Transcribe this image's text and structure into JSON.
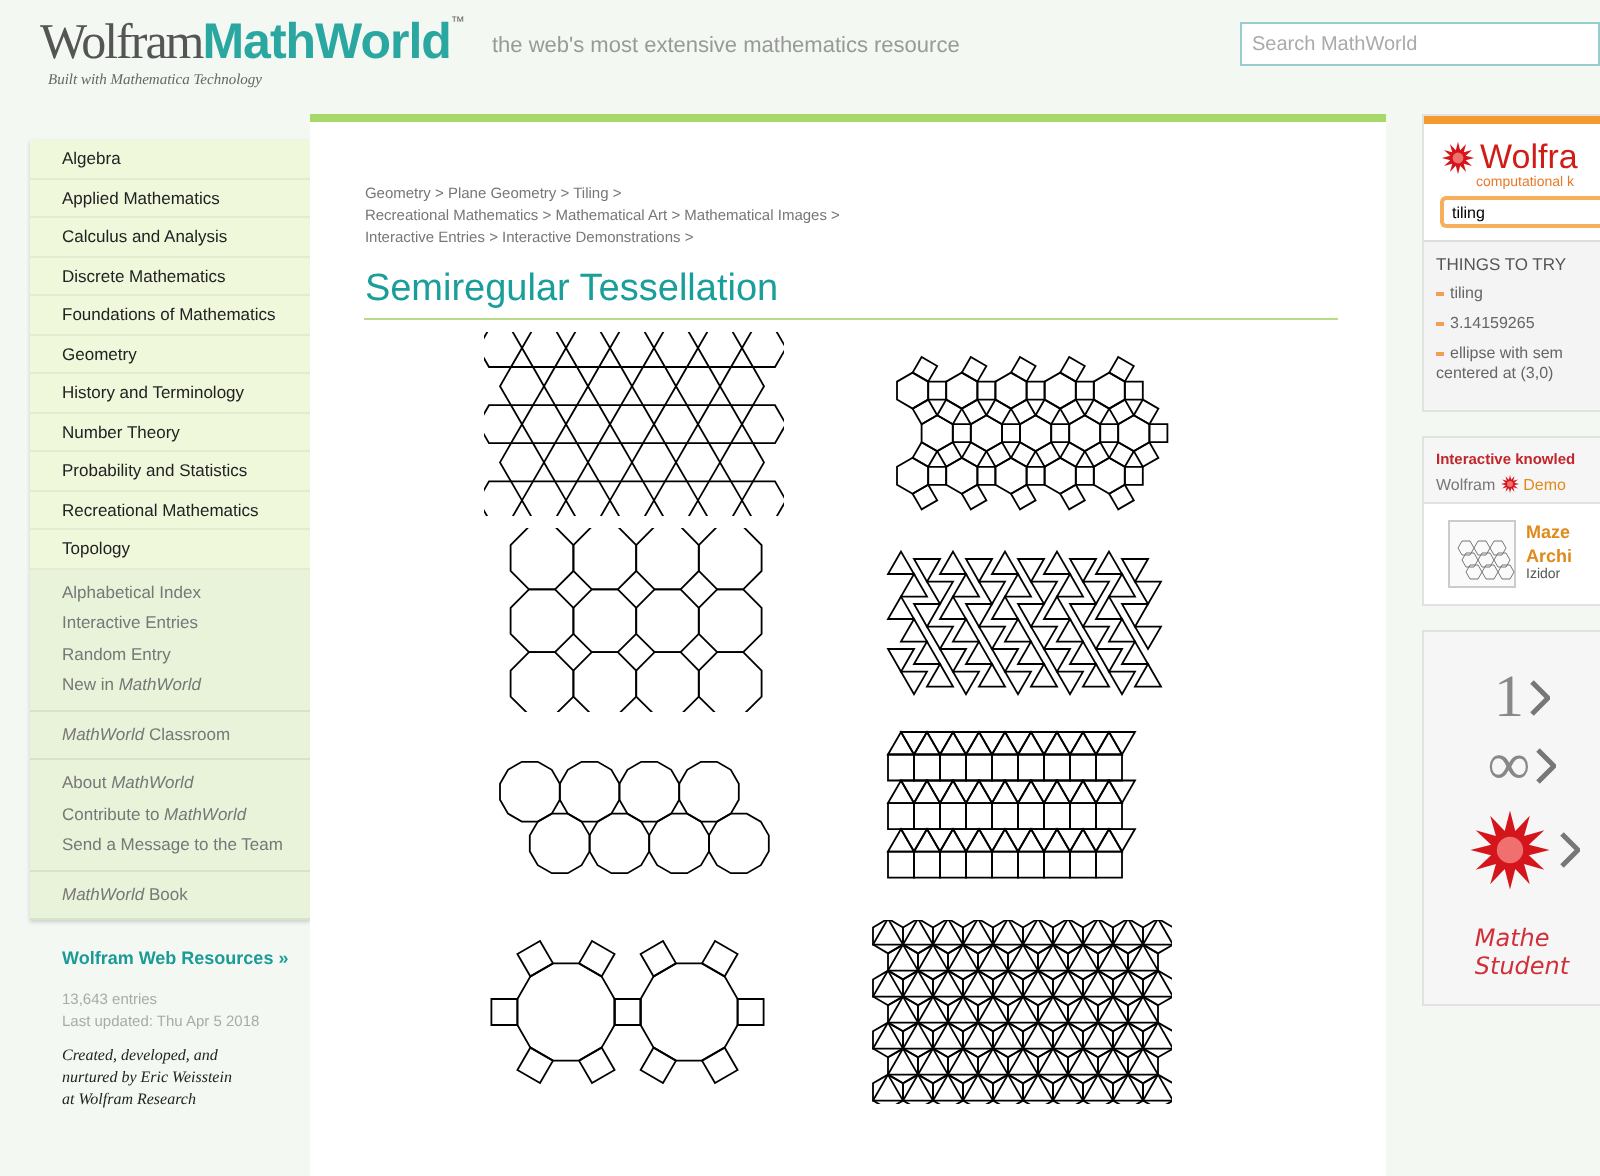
{
  "header": {
    "logo_left": "Wolfram",
    "logo_right": "MathWorld",
    "trademark": "™",
    "tagline": "the web's most extensive mathematics resource",
    "subtitle": "Built with Mathematica Technology",
    "search": {
      "placeholder": "Search MathWorld"
    }
  },
  "sidebar": {
    "topics": [
      "Algebra",
      "Applied Mathematics",
      "Calculus and Analysis",
      "Discrete Mathematics",
      "Foundations of Mathematics",
      "Geometry",
      "History and Terminology",
      "Number Theory",
      "Probability and Statistics",
      "Recreational Mathematics",
      "Topology"
    ],
    "groups": [
      [
        "Alphabetical Index",
        "Interactive Entries",
        "Random Entry",
        "New in *MathWorld*"
      ],
      [
        "*MathWorld* Classroom"
      ],
      [
        "About *MathWorld*",
        "Contribute to *MathWorld*",
        "Send a Message to the Team"
      ],
      [
        "*MathWorld* Book"
      ]
    ],
    "resources_link": "Wolfram Web Resources »",
    "entries": "13,643 entries",
    "updated": "Last updated: Thu Apr 5 2018",
    "credit": [
      "Created, developed, and",
      "nurtured by Eric Weisstein",
      "at Wolfram Research"
    ]
  },
  "breadcrumbs": [
    [
      "Geometry",
      "Plane Geometry",
      "Tiling"
    ],
    [
      "Recreational Mathematics",
      "Mathematical Art",
      "Mathematical Images"
    ],
    [
      "Interactive Entries",
      "Interactive Demonstrations"
    ]
  ],
  "separator": ">",
  "title": "Semiregular Tessellation",
  "alpha": {
    "logo": "Wolfra",
    "tag": "computational k",
    "query": "tiling",
    "things_title": "THINGS TO TRY",
    "things": [
      [
        "tiling"
      ],
      [
        "3.14159265"
      ],
      [
        "ellipse with sem",
        "centered at (3,0)"
      ]
    ]
  },
  "demos": {
    "heading": "Interactive knowled",
    "brand_left": "Wolfram",
    "brand_right": "Demo",
    "item_title": [
      "Maze",
      "Archi"
    ],
    "item_author": "Izidor"
  },
  "promo": {
    "lines": [
      "1",
      "∞"
    ],
    "caption": [
      "Mathe",
      "Student"
    ]
  }
}
